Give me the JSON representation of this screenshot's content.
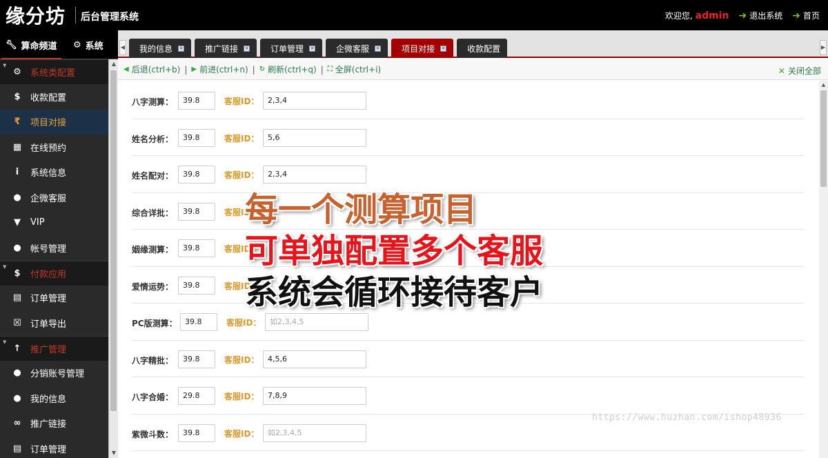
{
  "header": {
    "logo": "缘分坊",
    "system_title": "后台管理系统",
    "welcome": "欢迎您,",
    "username": "admin",
    "logout": "退出系统",
    "home": "首页"
  },
  "sidebar": {
    "tabs": [
      {
        "label": "算命频道",
        "icon": "wrench-icon"
      },
      {
        "label": "系统",
        "icon": "gears-icon"
      }
    ],
    "groups": [
      {
        "label": "系统类配置",
        "icon": "gear-icon",
        "items": [
          {
            "label": "收款配置",
            "icon": "dollar-icon"
          },
          {
            "label": "项目对接",
            "icon": "rupee-icon"
          },
          {
            "label": "在线预约",
            "icon": "calendar-icon"
          },
          {
            "label": "系统信息",
            "icon": "info-icon"
          },
          {
            "label": "企微客服",
            "icon": "chat-icon"
          },
          {
            "label": "VIP",
            "icon": "trophy-icon"
          },
          {
            "label": "帐号管理",
            "icon": "user-icon"
          }
        ]
      },
      {
        "label": "付款应用",
        "icon": "dollar-icon",
        "items": [
          {
            "label": "订单管理",
            "icon": "book-icon"
          },
          {
            "label": "订单导出",
            "icon": "excel-icon"
          }
        ]
      },
      {
        "label": "推广管理",
        "icon": "up-arrow-icon",
        "items": [
          {
            "label": "分销账号管理",
            "icon": "users-icon"
          },
          {
            "label": "我的信息",
            "icon": "user-icon"
          },
          {
            "label": "推广链接",
            "icon": "link-icon"
          },
          {
            "label": "订单管理",
            "icon": "book-icon"
          }
        ]
      }
    ]
  },
  "tabs": [
    {
      "label": "我的信息"
    },
    {
      "label": "推广链接"
    },
    {
      "label": "订单管理"
    },
    {
      "label": "企微客服"
    },
    {
      "label": "项目对接",
      "active": true
    },
    {
      "label": "收款配置"
    }
  ],
  "toolbar": {
    "back": "后退(ctrl+b)",
    "forward": "前进(ctrl+n)",
    "refresh": "刷新(ctrl+q)",
    "fullscreen": "全屏(ctrl+i)",
    "close_all": "关闭全部"
  },
  "form": {
    "cs_label": "客服ID：",
    "rows": [
      {
        "label": "八字测算：",
        "price": "39.8",
        "cs": "2,3,4"
      },
      {
        "label": "姓名分析：",
        "price": "39.8",
        "cs": "5,6"
      },
      {
        "label": "姓名配对：",
        "price": "39.8",
        "cs": "2,3,4"
      },
      {
        "label": "综合详批：",
        "price": "39.8",
        "cs": ""
      },
      {
        "label": "姻缘测算：",
        "price": "39.8",
        "cs": ""
      },
      {
        "label": "爱情运势：",
        "price": "39.8",
        "cs": ""
      },
      {
        "label": "PC版测算：",
        "price": "39.8",
        "cs": "",
        "placeholder": "如2,3,4,5"
      },
      {
        "label": "八字精批：",
        "price": "39.8",
        "cs": "4,5,6"
      },
      {
        "label": "八字合婚：",
        "price": "29.8",
        "cs": "7,8,9"
      },
      {
        "label": "紫微斗数：",
        "price": "39.8",
        "cs": "",
        "placeholder": "如2,3,4,5"
      }
    ]
  },
  "overlay": {
    "line1": "每一个测算项目",
    "line2": "可单独配置多个客服",
    "line3": "系统会循环接待客户"
  },
  "watermark": "https://www.huzhan.com/ishop48936",
  "colors": {
    "active_tab": "#a40000",
    "accent_orange": "#d99a2b",
    "toolbar_green": "#2a7a4a",
    "admin_red": "#e8202a"
  }
}
